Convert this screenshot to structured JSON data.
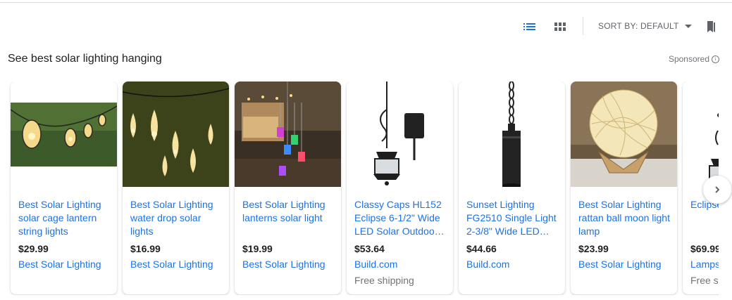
{
  "toolbar": {
    "list_view_icon": "list-view-icon",
    "grid_view_icon": "grid-view-icon",
    "sort_label": "SORT BY: DEFAULT",
    "bookmark_icon": "bookmark-icon"
  },
  "section": {
    "heading": "See best solar lighting hanging",
    "sponsored": "Sponsored",
    "info_glyph": "i"
  },
  "products": [
    {
      "title": "Best Solar Lighting solar cage lantern string lights",
      "price": "$29.99",
      "merchant": "Best Solar Lighting",
      "shipping": ""
    },
    {
      "title": "Best Solar Lighting water drop solar lights",
      "price": "$16.99",
      "merchant": "Best Solar Lighting",
      "shipping": ""
    },
    {
      "title": "Best Solar Lighting lanterns solar light",
      "price": "$19.99",
      "merchant": "Best Solar Lighting",
      "shipping": ""
    },
    {
      "title": "Classy Caps HL152 Eclipse 6-1/2\" Wide LED Solar Outdoo…",
      "price": "$53.64",
      "merchant": "Build.com",
      "shipping": "Free shipping"
    },
    {
      "title": "Sunset Lighting FG2510 Single Light 2-3/8\" Wide LED…",
      "price": "$44.66",
      "merchant": "Build.com",
      "shipping": ""
    },
    {
      "title": "Best Solar Lighting rattan ball moon light lamp",
      "price": "$23.99",
      "merchant": "Best Solar Lighting",
      "shipping": ""
    },
    {
      "title": "Eclipse Black LED H",
      "price": "$69.99",
      "merchant": "Lamps",
      "shipping": "Free s"
    }
  ],
  "colors": {
    "link": "#1a73e8",
    "accent_icon": "#1a73e8",
    "muted": "#70757a"
  }
}
